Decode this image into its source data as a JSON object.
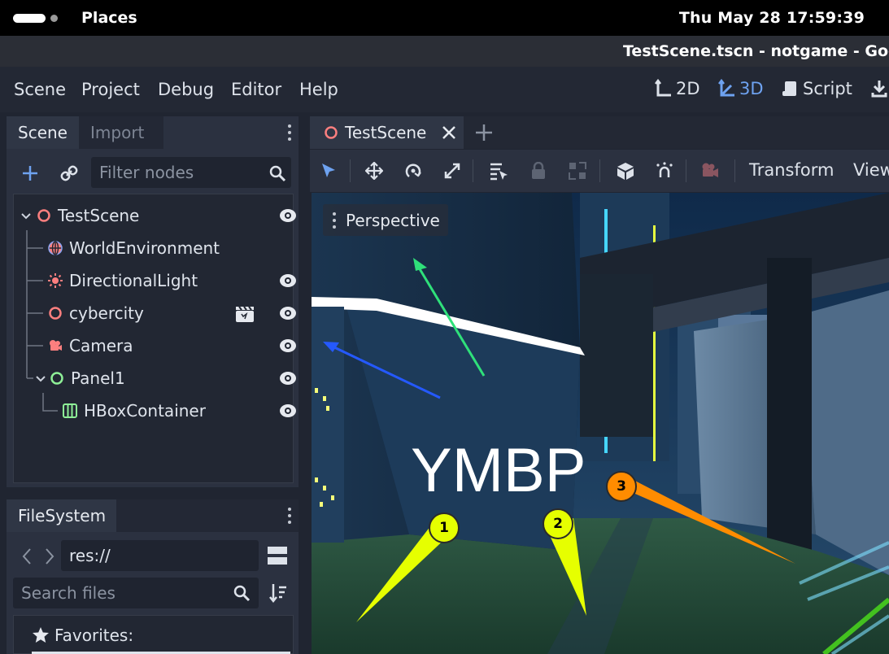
{
  "os_bar": {
    "places": "Places",
    "datetime": "Thu May 28  17:59:39"
  },
  "window": {
    "title": "TestScene.tscn - notgame - Godot E"
  },
  "menu": [
    "Scene",
    "Project",
    "Debug",
    "Editor",
    "Help"
  ],
  "modes": {
    "2d": "2D",
    "3d": "3D",
    "script": "Script",
    "active": "3D"
  },
  "scene_dock": {
    "tabs": {
      "scene": "Scene",
      "import": "Import"
    },
    "filter_placeholder": "Filter nodes",
    "nodes": [
      {
        "name": "TestScene",
        "icon": "node3d-icon",
        "visible_toggle": true
      },
      {
        "name": "WorldEnvironment",
        "icon": "world-environment-icon",
        "visible_toggle": false
      },
      {
        "name": "DirectionalLight",
        "icon": "directional-light-icon",
        "visible_toggle": true
      },
      {
        "name": "cybercity",
        "icon": "node3d-icon",
        "visible_toggle": true,
        "extra_icon": "clapperboard-icon"
      },
      {
        "name": "Camera",
        "icon": "camera-icon",
        "visible_toggle": true
      },
      {
        "name": "Panel1",
        "icon": "control-icon",
        "visible_toggle": true
      },
      {
        "name": "HBoxContainer",
        "icon": "hbox-container-icon",
        "visible_toggle": true
      }
    ]
  },
  "filesystem_dock": {
    "tab": "FileSystem",
    "path": "res://",
    "search_placeholder": "Search files",
    "favorites_label": "Favorites:"
  },
  "viewport": {
    "tab": "TestScene",
    "toolbar": {
      "transform": "Transform",
      "view": "View"
    },
    "perspective_label": "Perspective",
    "overlay_text": "YMBP",
    "callouts": [
      "1",
      "2",
      "3"
    ]
  },
  "colors": {
    "accent": "#6ea2f0",
    "node3d": "#fc7f7f",
    "control": "#8eef97",
    "callout_yellow": "#e6ff00",
    "callout_orange": "#ff8c00"
  }
}
